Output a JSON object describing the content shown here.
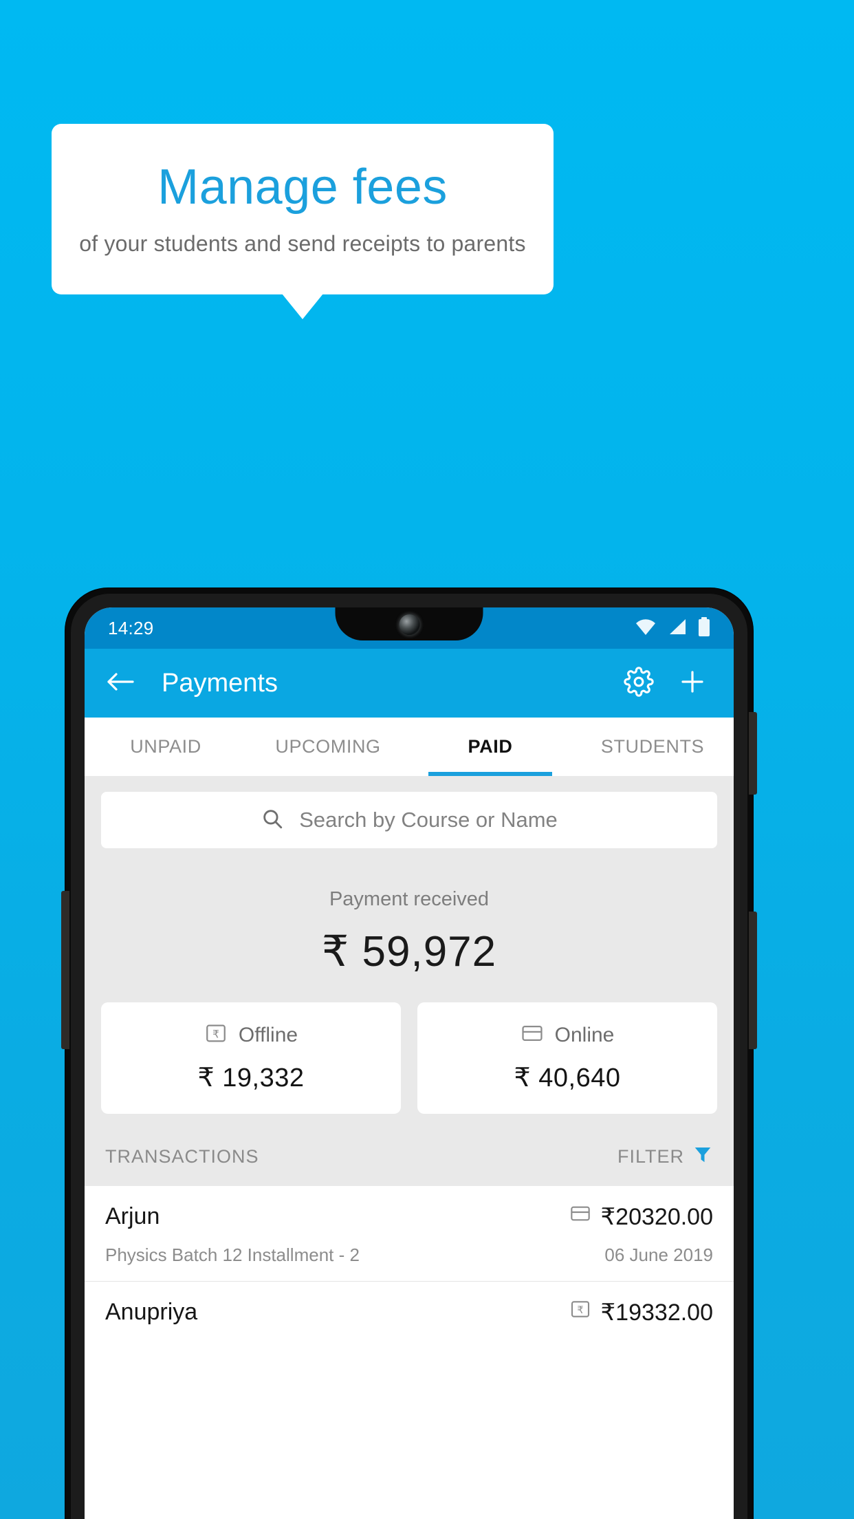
{
  "promo": {
    "title": "Manage fees",
    "subtitle": "of your students and send receipts to parents",
    "title_color": "#1ba0dd",
    "background_color": "#00b9f2"
  },
  "phone": {
    "status_bar": {
      "time": "14:29",
      "icons": [
        "wifi-icon",
        "cellular-signal-icon",
        "battery-icon"
      ],
      "background_color": "#0287c9"
    },
    "app_bar": {
      "back_icon": "arrow-left-icon",
      "title": "Payments",
      "settings_icon": "gear-icon",
      "add_icon": "plus-icon",
      "background_color": "#0aa7e2"
    },
    "tabs": [
      {
        "label": "UNPAID",
        "active": false
      },
      {
        "label": "UPCOMING",
        "active": false
      },
      {
        "label": "PAID",
        "active": true
      },
      {
        "label": "STUDENTS",
        "active": false
      }
    ],
    "search": {
      "icon": "search-icon",
      "placeholder": "Search by Course or Name",
      "value": ""
    },
    "summary": {
      "label": "Payment received",
      "amount": "₹ 59,972"
    },
    "method_cards": [
      {
        "icon": "rupee-note-icon",
        "label": "Offline",
        "amount": "₹ 19,332"
      },
      {
        "icon": "credit-card-icon",
        "label": "Online",
        "amount": "₹ 40,640"
      }
    ],
    "list_header": {
      "title": "TRANSACTIONS",
      "filter_label": "FILTER",
      "filter_icon": "funnel-icon",
      "filter_icon_color": "#1ba0dd"
    },
    "transactions": [
      {
        "name": "Arjun",
        "detail": "Physics Batch 12 Installment - 2",
        "amount": "₹20320.00",
        "date": "06 June 2019",
        "method_icon": "credit-card-icon"
      },
      {
        "name": "Anupriya",
        "detail": "",
        "amount": "₹19332.00",
        "date": "",
        "method_icon": "rupee-note-icon"
      }
    ]
  }
}
